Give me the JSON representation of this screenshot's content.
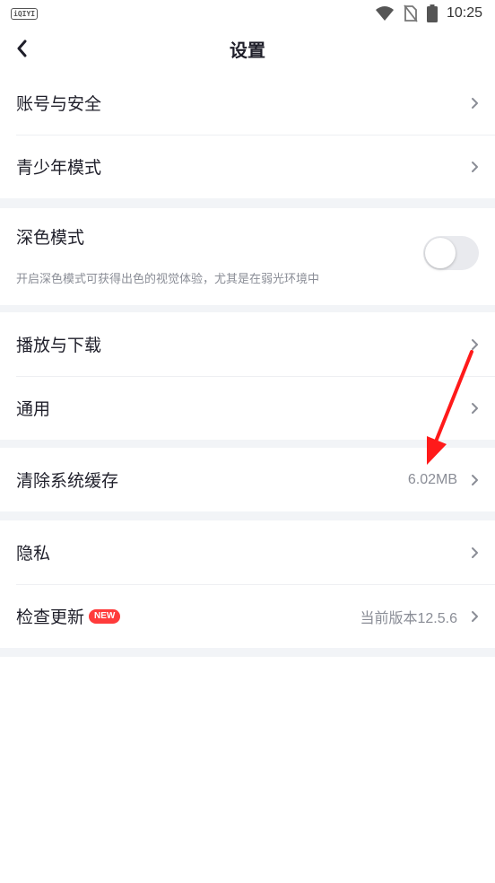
{
  "status_bar": {
    "app_badge": "iQIYI",
    "time": "10:25",
    "icons": [
      "wifi-icon",
      "no-sim-icon",
      "battery-icon"
    ]
  },
  "header": {
    "title": "设置",
    "back_icon": "back-chevron-icon"
  },
  "sections": {
    "account": {
      "items": [
        {
          "label": "账号与安全"
        },
        {
          "label": "青少年模式"
        }
      ]
    },
    "dark_mode": {
      "title": "深色模式",
      "description": "开启深色模式可获得出色的视觉体验，尤其是在弱光环境中",
      "enabled": false
    },
    "playback": {
      "items": [
        {
          "label": "播放与下载"
        },
        {
          "label": "通用"
        }
      ]
    },
    "cache": {
      "label": "清除系统缓存",
      "value": "6.02MB"
    },
    "misc": {
      "privacy_label": "隐私",
      "update_label": "检查更新",
      "update_badge": "NEW",
      "version_text": "当前版本12.5.6"
    }
  },
  "colors": {
    "text_primary": "#1f1f2a",
    "text_secondary": "#8a8d96",
    "divider_gap": "#f2f4f7",
    "badge_red": "#ff3b3b",
    "annotation_arrow": "#ff1a1a"
  }
}
